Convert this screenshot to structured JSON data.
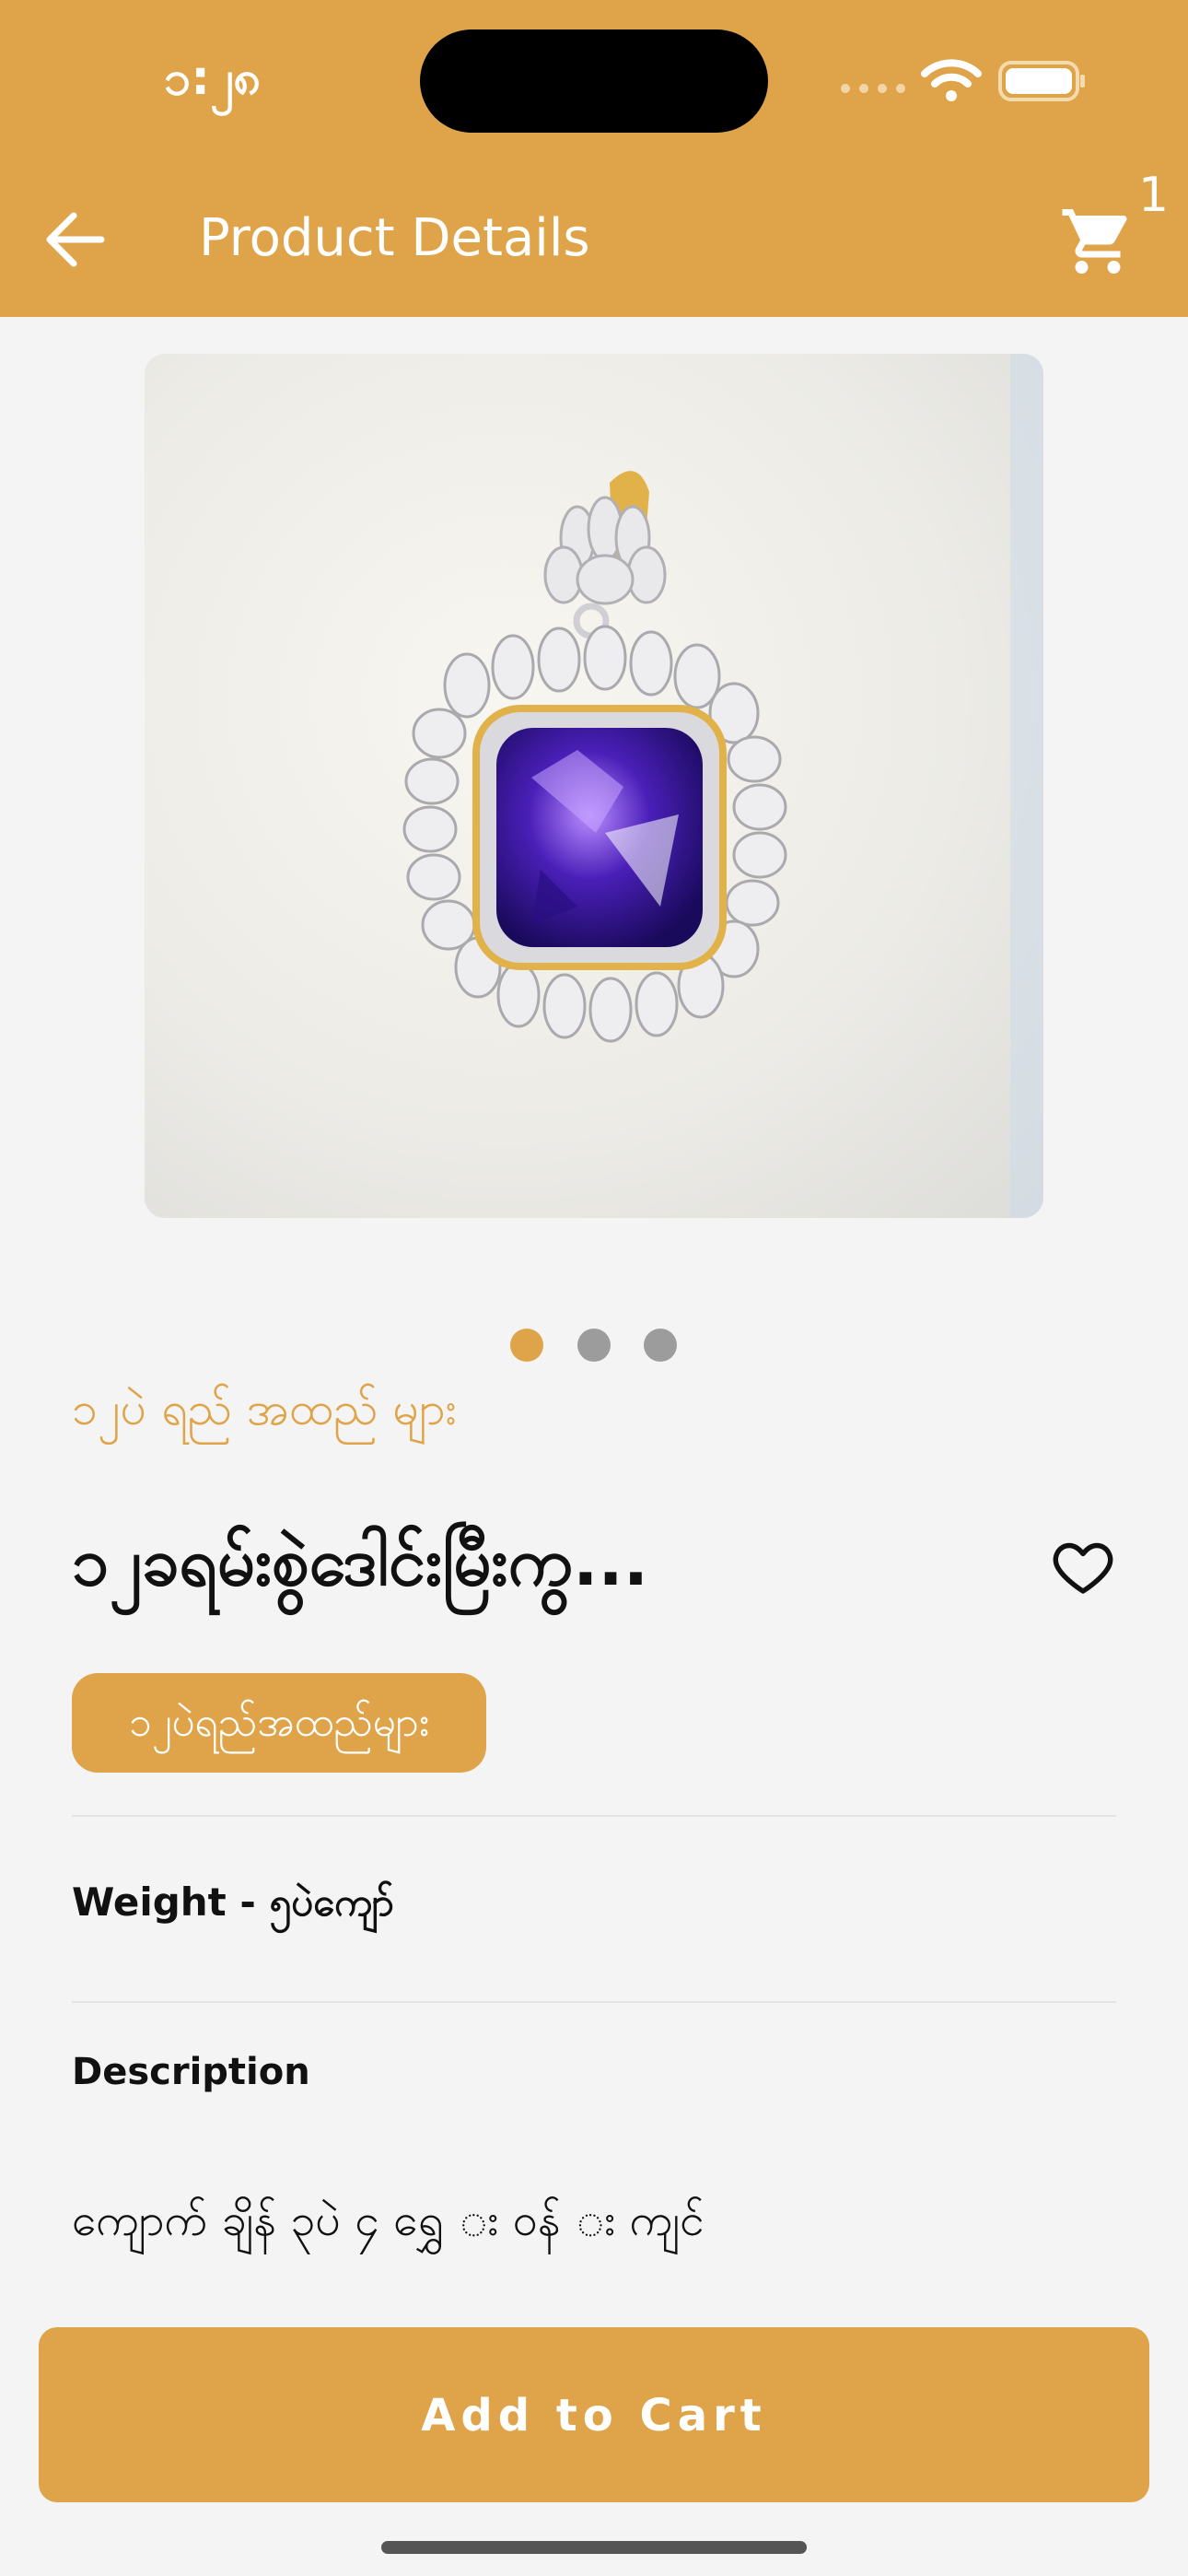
{
  "status_bar": {
    "time": "၁:၂၈"
  },
  "header": {
    "title": "Product Details",
    "cart_count": "1"
  },
  "carousel": {
    "image_count": 3,
    "active_index": 0
  },
  "product": {
    "category": "၁၂ပဲ ရည် အထည် များ",
    "name": "၁၂ခရမ်းစွဲဒေါင်းမြီးကွ...",
    "tag": "၁၂ပဲရည်အထည်များ",
    "weight": "Weight - ၅ပဲကျော်",
    "description_heading": "Description",
    "description": "ကျောက် ချိန် ၃ပဲ ၄ ရွှေ း ၀န် း ကျင်"
  },
  "actions": {
    "add_to_cart": "Add to Cart"
  },
  "colors": {
    "accent": "#dfa44a",
    "background": "#f4f4f4",
    "inactive_dot": "#9c9c9c"
  }
}
